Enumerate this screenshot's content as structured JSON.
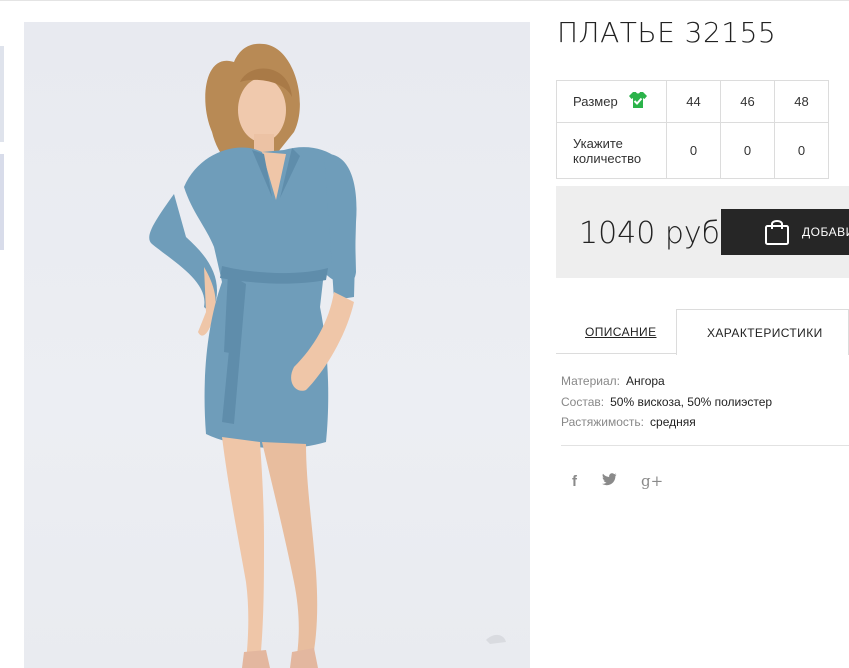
{
  "product": {
    "title": "ПЛАТЬЕ 32155",
    "price": "1040 руб",
    "add_to_cart_label": "ДОБАВИ"
  },
  "sizes": {
    "size_label": "Размер",
    "size_icon": "tshirt-check-icon",
    "qty_label": "Укажите количество",
    "values": [
      "44",
      "46",
      "48"
    ],
    "quantities": [
      "0",
      "0",
      "0"
    ]
  },
  "tabs": {
    "description": "ОПИСАНИЕ",
    "characteristics": "ХАРАКТЕРИСТИКИ"
  },
  "specs": [
    {
      "key": "Материал:",
      "value": "Ангора"
    },
    {
      "key": "Состав:",
      "value": "50% вискоза, 50% полиэстер"
    },
    {
      "key": "Растяжимость:",
      "value": "средняя"
    }
  ],
  "social": {
    "facebook": "f",
    "twitter": "twitter-icon",
    "googleplus": "g+"
  },
  "colors": {
    "dress": "#6f9dba",
    "button": "#262626",
    "check_green": "#2bb34a"
  }
}
